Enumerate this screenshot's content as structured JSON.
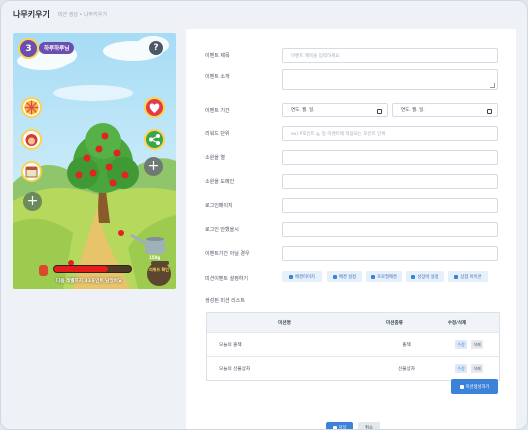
{
  "header": {
    "title": "나무키우기",
    "crumb_parent": "미션 생성",
    "crumb_sep": "•",
    "crumb_current": "나무키우기"
  },
  "game": {
    "level": "3",
    "level_name": "하루하루님",
    "help": "?",
    "progress_message": "다음 레벨까지 33포인트 남았어요",
    "water_label": "150g",
    "reward_label": "리워드 확인",
    "plus": "+",
    "progress_fraction": 0.7
  },
  "form": {
    "fields": [
      {
        "label": "이벤트 제목",
        "placeholder": "이벤트 제목을 입력하세요",
        "kind": "text"
      },
      {
        "label": "이벤트 소개",
        "placeholder": "",
        "kind": "textarea"
      },
      {
        "label": "이벤트 기간",
        "start": "연도. 월. 일.",
        "end": "연도. 월. 일.",
        "kind": "date"
      },
      {
        "label": "리워드 단위",
        "placeholder": "ex) P포인트 g, 등 이벤트에 적용되는 포인트 단위",
        "kind": "text"
      },
      {
        "label": "소원을 열",
        "placeholder": "",
        "kind": "text"
      },
      {
        "label": "소원을 도메인",
        "placeholder": "",
        "kind": "text"
      },
      {
        "label": "로그인페이지",
        "placeholder": "",
        "kind": "text"
      },
      {
        "label": "로그인 안했을시",
        "placeholder": "",
        "kind": "text"
      },
      {
        "label": "이벤트기간 아닐 경우",
        "placeholder": "",
        "kind": "text"
      }
    ],
    "mission_settings_label": "미션이벤트 설정하기",
    "mission_buttons": [
      "배경이미지",
      "배경 설정",
      "프로필배경",
      "성장바 설정",
      "상점 아이콘"
    ],
    "list_title": "생성된 미션 리스트",
    "table": {
      "headers": [
        "미션명",
        "미션종류",
        "수정/삭제"
      ],
      "rows": [
        {
          "name": "오늘의 출첵",
          "type": "출첵"
        },
        {
          "name": "오늘의 선물상자",
          "type": "선물상자"
        }
      ],
      "edit_label": "수정",
      "delete_label": "삭제"
    },
    "create_mission_label": "미션생성하기",
    "save_label": "저장",
    "cancel_label": "취소"
  },
  "colors": {
    "accent": "#3d82d9",
    "progress": "#e51c1c"
  }
}
